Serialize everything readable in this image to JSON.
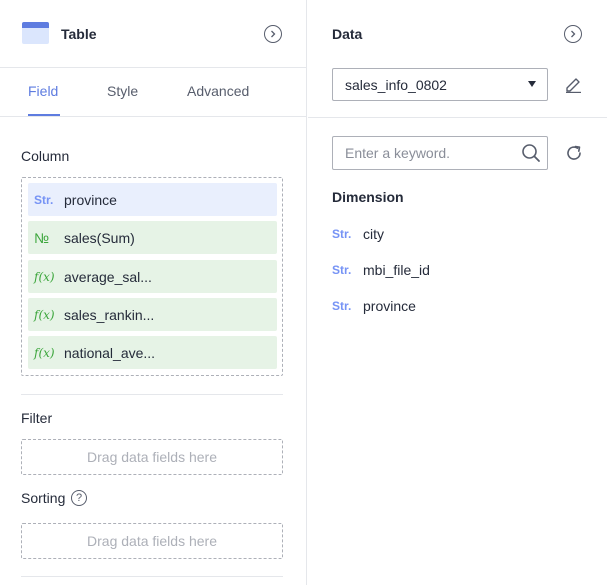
{
  "left_panel": {
    "title": "Table",
    "tabs": [
      {
        "label": "Field",
        "active": true
      },
      {
        "label": "Style",
        "active": false
      },
      {
        "label": "Advanced",
        "active": false
      }
    ],
    "column": {
      "label": "Column",
      "fields": [
        {
          "tag": "Str.",
          "kind": "string",
          "name": "province"
        },
        {
          "tag": "№",
          "kind": "number",
          "name": "sales(Sum)"
        },
        {
          "tag": "f(x)",
          "kind": "formula",
          "name": "average_sal..."
        },
        {
          "tag": "f(x)",
          "kind": "formula",
          "name": "sales_rankin..."
        },
        {
          "tag": "f(x)",
          "kind": "formula",
          "name": "national_ave..."
        }
      ]
    },
    "filter": {
      "label": "Filter",
      "drop_hint": "Drag data fields here"
    },
    "sorting": {
      "label": "Sorting",
      "help": "?",
      "drop_hint": "Drag data fields here"
    }
  },
  "right_panel": {
    "title": "Data",
    "dataset": {
      "value": "sales_info_0802"
    },
    "search": {
      "placeholder": "Enter a keyword."
    },
    "dimension": {
      "title": "Dimension",
      "items": [
        {
          "tag": "Str.",
          "name": "city"
        },
        {
          "tag": "Str.",
          "name": "mbi_file_id"
        },
        {
          "tag": "Str.",
          "name": "province"
        }
      ]
    }
  },
  "colors": {
    "accent": "#5e7ce0",
    "str_tag": "#7693f5",
    "num_bg": "#e6f3e6",
    "str_bg": "#e9effd"
  },
  "icons": [
    "table-icon",
    "collapse-arrow-icon",
    "chevron-down-icon",
    "edit-icon",
    "search-icon",
    "refresh-icon",
    "help-icon"
  ]
}
